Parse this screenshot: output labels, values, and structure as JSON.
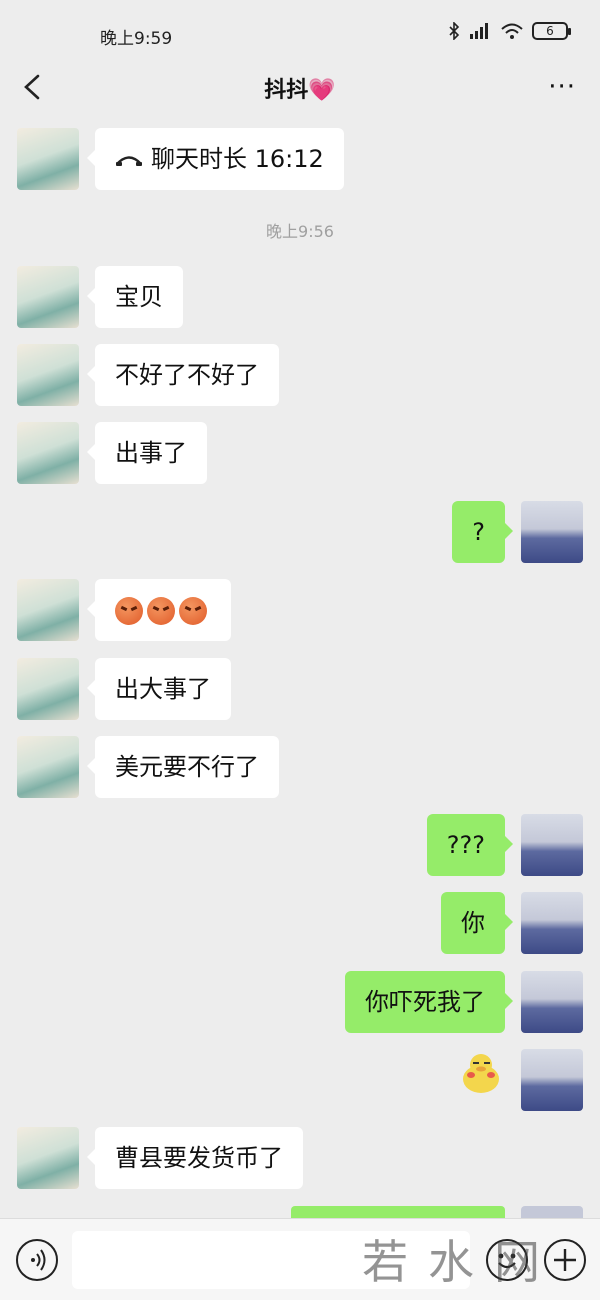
{
  "status_bar": {
    "time": "晚上9:59",
    "battery": "6"
  },
  "nav": {
    "title": "抖抖💗",
    "more": "···"
  },
  "messages": {
    "call": {
      "text": "聊天时长 16:12"
    },
    "timestamp": "晚上9:56",
    "m1": "宝贝",
    "m2": "不好了不好了",
    "m3": "出事了",
    "m4": "?",
    "m5": "emoji: angry-face ×3",
    "m6": "出大事了",
    "m7": "美元要不行了",
    "m8": "???",
    "m9": "你",
    "m10": "你吓死我了",
    "m11": "sticker: yellow-duck",
    "m12": "曹县要发货币了"
  },
  "input": {
    "placeholder": ""
  },
  "watermark": "若水网",
  "colors": {
    "background": "#ededed",
    "self_bubble": "#95ec69",
    "other_bubble": "#ffffff"
  }
}
